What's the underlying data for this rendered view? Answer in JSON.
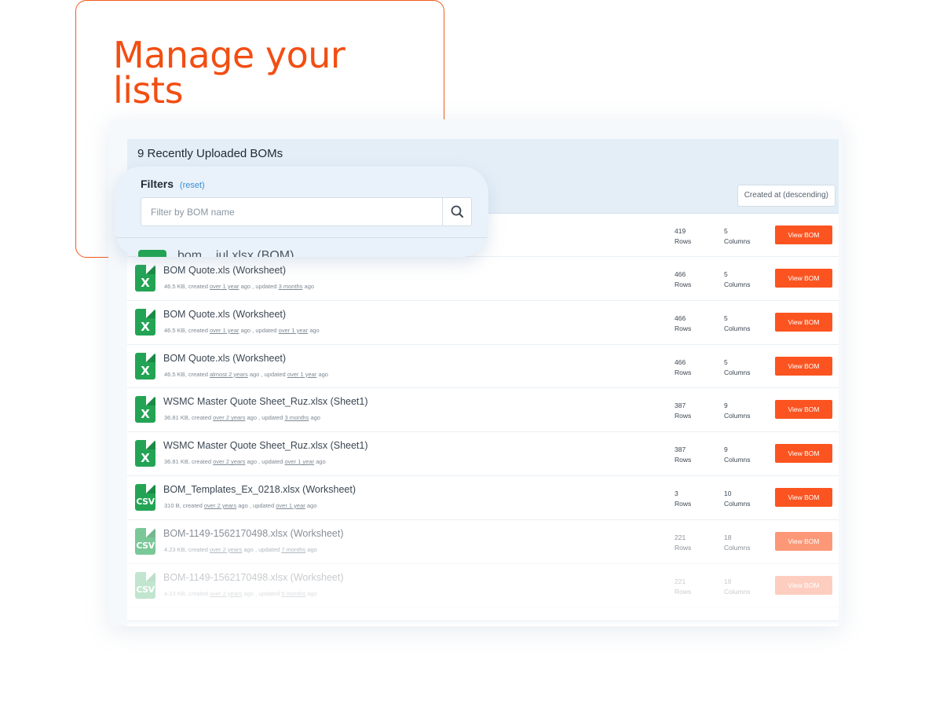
{
  "hero": {
    "title": "Manage your lists"
  },
  "header": {
    "title": "9 Recently Uploaded BOMs",
    "sort_label": "Created at (descending)"
  },
  "filters": {
    "title": "Filters",
    "reset_label": "(reset)",
    "search_placeholder": "Filter by BOM name",
    "ghost_row_text": "bom....jul.xlsx (BOM)"
  },
  "boms": [
    {
      "name": "",
      "meta_size": "",
      "created": "",
      "updated": "",
      "rows": "419",
      "columns": "5",
      "type": "xlsx",
      "opacity": 1
    },
    {
      "name": "BOM Quote.xls (Worksheet)",
      "meta_size": "46.5 KB, created",
      "created": "over 1 year",
      "updated": "3 months",
      "rows": "466",
      "columns": "5",
      "type": "xlsx",
      "opacity": 1
    },
    {
      "name": "BOM Quote.xls (Worksheet)",
      "meta_size": "46.5 KB, created",
      "created": "over 1 year",
      "updated": "over 1 year",
      "rows": "466",
      "columns": "5",
      "type": "xlsx",
      "opacity": 1
    },
    {
      "name": "BOM Quote.xls (Worksheet)",
      "meta_size": "46.5 KB, created",
      "created": "almost 2 years",
      "updated": "over 1 year",
      "rows": "466",
      "columns": "5",
      "type": "xlsx",
      "opacity": 1
    },
    {
      "name": "WSMC Master Quote Sheet_Ruz.xlsx (Sheet1)",
      "meta_size": "36.81 KB, created",
      "created": "over 2 years",
      "updated": "3 months",
      "rows": "387",
      "columns": "9",
      "type": "xlsx",
      "opacity": 1
    },
    {
      "name": "WSMC Master Quote Sheet_Ruz.xlsx (Sheet1)",
      "meta_size": "36.81 KB, created",
      "created": "over 2 years",
      "updated": "over 1 year",
      "rows": "387",
      "columns": "9",
      "type": "xlsx",
      "opacity": 1
    },
    {
      "name": "BOM_Templates_Ex_0218.xlsx (Worksheet)",
      "meta_size": "310 B, created",
      "created": "over 2 years",
      "updated": "over 1 year",
      "rows": "3",
      "columns": "10",
      "type": "csv",
      "opacity": 1
    },
    {
      "name": "BOM-1149-1562170498.xlsx (Worksheet)",
      "meta_size": "4.23 KB, created",
      "created": "over 2 years",
      "updated": "7 months",
      "rows": "221",
      "columns": "18",
      "type": "csv",
      "opacity": 0.6
    },
    {
      "name": "BOM-1149-1562170498.xlsx (Worksheet)",
      "meta_size": "4.23 KB, created",
      "created": "over 2 years",
      "updated": "5 months",
      "rows": "221",
      "columns": "18",
      "type": "csv",
      "opacity": 0.28
    }
  ],
  "labels": {
    "rows_unit": "Rows",
    "columns_unit": "Columns",
    "view_button": "View BOM",
    "ago": "ago",
    "updated_prefix": ", updated",
    "icon_xlsx": "X",
    "icon_csv": "CSV"
  },
  "icons": {
    "xlsx": "excel-file-icon",
    "csv": "csv-file-icon",
    "search": "search-icon"
  },
  "colors": {
    "accent": "#fb5420",
    "brand_title": "#f24e12",
    "file_green": "#23a455",
    "link": "#3b8fd4"
  }
}
